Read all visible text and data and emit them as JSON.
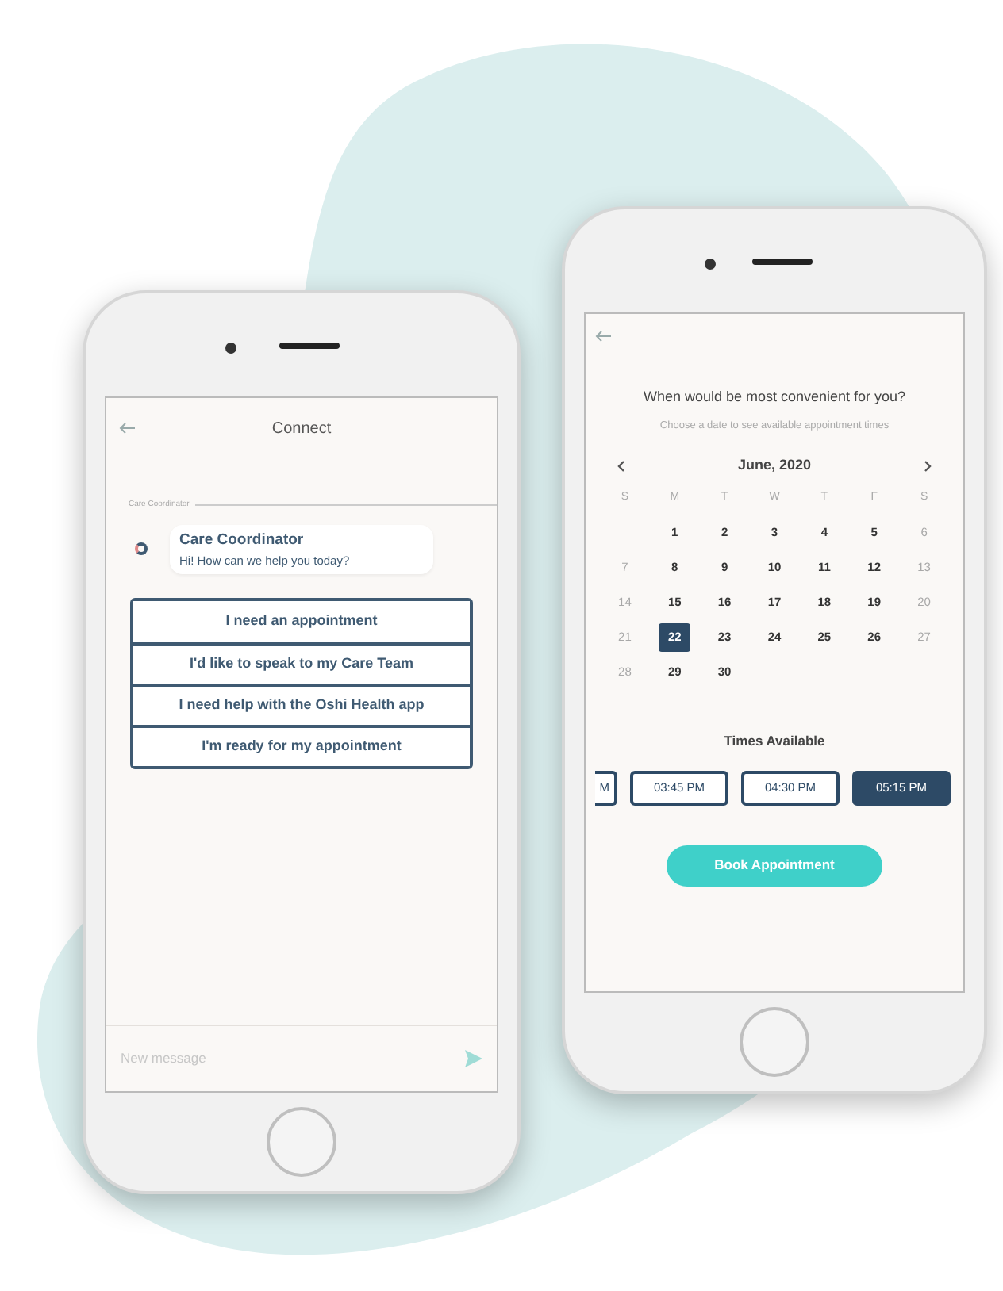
{
  "chat_screen": {
    "title": "Connect",
    "section_label": "Care Coordinator",
    "message": {
      "sender": "Care Coordinator",
      "text": "Hi! How can we help you today?"
    },
    "options": [
      "I need an appointment",
      "I'd like to speak to my Care Team",
      "I need help with the Oshi Health app",
      "I'm ready for my appointment"
    ],
    "composer": {
      "placeholder": "New message"
    }
  },
  "booking_screen": {
    "question": "When would be most convenient for you?",
    "hint": "Choose a date to see available appointment times",
    "month": "June, 2020",
    "weekdays": [
      "S",
      "M",
      "T",
      "W",
      "T",
      "F",
      "S"
    ],
    "weeks": [
      [
        {
          "day": "1",
          "disabled": false,
          "selected": false
        },
        {
          "day": "2",
          "disabled": false,
          "selected": false
        },
        {
          "day": "3",
          "disabled": false,
          "selected": false
        },
        {
          "day": "4",
          "disabled": false,
          "selected": false
        },
        {
          "day": "5",
          "disabled": false,
          "selected": false
        },
        {
          "day": "6",
          "disabled": true,
          "selected": false
        }
      ],
      [
        {
          "day": "7",
          "disabled": true,
          "selected": false
        },
        {
          "day": "8",
          "disabled": false,
          "selected": false
        },
        {
          "day": "9",
          "disabled": false,
          "selected": false
        },
        {
          "day": "10",
          "disabled": false,
          "selected": false
        },
        {
          "day": "11",
          "disabled": false,
          "selected": false
        },
        {
          "day": "12",
          "disabled": false,
          "selected": false
        },
        {
          "day": "13",
          "disabled": true,
          "selected": false
        }
      ],
      [
        {
          "day": "14",
          "disabled": true,
          "selected": false
        },
        {
          "day": "15",
          "disabled": false,
          "selected": false
        },
        {
          "day": "16",
          "disabled": false,
          "selected": false
        },
        {
          "day": "17",
          "disabled": false,
          "selected": false
        },
        {
          "day": "18",
          "disabled": false,
          "selected": false
        },
        {
          "day": "19",
          "disabled": false,
          "selected": false
        },
        {
          "day": "20",
          "disabled": true,
          "selected": false
        }
      ],
      [
        {
          "day": "21",
          "disabled": true,
          "selected": false
        },
        {
          "day": "22",
          "disabled": false,
          "selected": true
        },
        {
          "day": "23",
          "disabled": false,
          "selected": false
        },
        {
          "day": "24",
          "disabled": false,
          "selected": false
        },
        {
          "day": "25",
          "disabled": false,
          "selected": false
        },
        {
          "day": "26",
          "disabled": false,
          "selected": false
        },
        {
          "day": "27",
          "disabled": true,
          "selected": false
        }
      ],
      [
        {
          "day": "28",
          "disabled": true,
          "selected": false
        },
        {
          "day": "29",
          "disabled": false,
          "selected": false
        },
        {
          "day": "30",
          "disabled": false,
          "selected": false
        }
      ]
    ],
    "times_heading": "Times Available",
    "times": [
      {
        "label": "M",
        "selected": false
      },
      {
        "label": "03:45 PM",
        "selected": false
      },
      {
        "label": "04:30 PM",
        "selected": false
      },
      {
        "label": "05:15 PM",
        "selected": true
      }
    ],
    "book_button": "Book Appointment"
  }
}
